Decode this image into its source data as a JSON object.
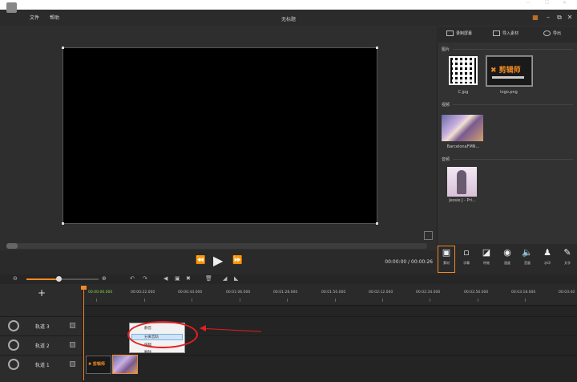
{
  "app": {
    "title": "无标题",
    "menu": [
      "文件",
      "帮助"
    ]
  },
  "window_controls": {
    "minimize": "—",
    "maximize": "☐",
    "close": "✕"
  },
  "library": {
    "tabs": [
      "录制屏幕",
      "导入素材",
      "导出"
    ],
    "sections": {
      "images": "图片",
      "video": "视频",
      "audio": "音频"
    },
    "items": {
      "image1": "C.jpg",
      "image2": "logo.png",
      "video1": "BarcelonaFMN...",
      "audio1": "Jessie J - Pri..."
    },
    "logo_text": "✖ 剪辑师"
  },
  "player": {
    "timecode": "00:00:00 / 00:00:26"
  },
  "tools": [
    {
      "icon": "camera-icon",
      "label": "素材"
    },
    {
      "icon": "subtitle-icon",
      "label": "字幕"
    },
    {
      "icon": "overlay-icon",
      "label": "特效"
    },
    {
      "icon": "speed-icon",
      "label": "速度"
    },
    {
      "icon": "volume-icon",
      "label": "音量"
    },
    {
      "icon": "pin-icon",
      "label": "水印"
    },
    {
      "icon": "text-icon",
      "label": "文字"
    }
  ],
  "timeline": {
    "add_track": "+",
    "ticks": [
      "00:00:00.000",
      "00:00:22.000",
      "00:00:44.000",
      "00:01:06.000",
      "00:01:28.000",
      "00:01:50.000",
      "00:02:12.000",
      "00:02:34.000",
      "00:02:56.000",
      "00:03:18.000",
      "00:03:40"
    ],
    "tracks": [
      "轨道 3",
      "轨道 2",
      "轨道 1"
    ],
    "clip1_text": "✖ 剪辑师"
  },
  "context_menu": {
    "items": [
      "静音",
      "分离音轨",
      "编辑",
      "删除"
    ],
    "highlighted_index": 1
  },
  "colors": {
    "accent": "#f08a24",
    "annotation": "#e02020"
  }
}
